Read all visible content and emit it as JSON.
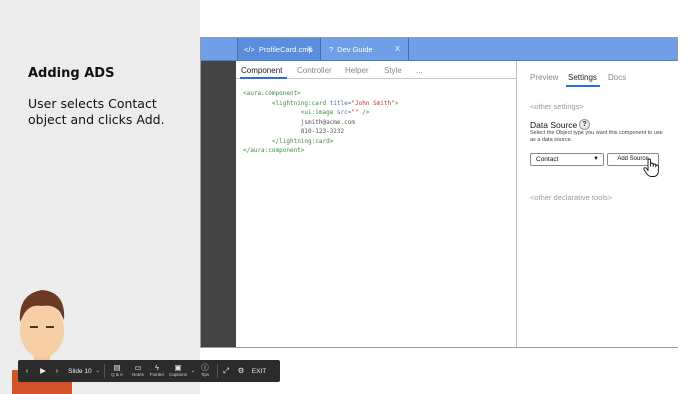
{
  "slide": {
    "title": "Adding ADS",
    "body": "User selects Contact object and clicks Add."
  },
  "player": {
    "prev_icon": "prev-icon",
    "play_icon": "play-icon",
    "next_icon": "next-icon",
    "slide_label": "Slide 10",
    "qa_label": "Q & A",
    "notes_label": "Notes",
    "pointer_label": "Pointer",
    "captions_label": "Captions",
    "tips_label": "Tips",
    "exit_label": "EXIT"
  },
  "tabs": [
    {
      "icon": "</>",
      "label": "ProfileCard.cmp",
      "close": "X"
    },
    {
      "icon": "?",
      "label": "Dev Guide",
      "close": "X"
    }
  ],
  "editor": {
    "tabs": [
      "Component",
      "Controller",
      "Helper",
      "Style",
      "..."
    ],
    "active_tab": "Component",
    "code": {
      "l1": "<aura:component>",
      "l2_tag": "<lightning:card",
      "l2_attr": " title=",
      "l2_val": "\"John Smith\"",
      "l2_end": ">",
      "l3_tag": "<ui:image",
      "l3_attr": " src=",
      "l3_val": "\"\"",
      "l3_end": " />",
      "l4": "jsmith@acme.com",
      "l5": "810-123-3232",
      "l6": "</lightning:card>",
      "l7": "</aura:component>"
    }
  },
  "panel": {
    "tabs": [
      "Preview",
      "Settings",
      "Docs"
    ],
    "active_tab": "Settings",
    "other_settings": "<other settings>",
    "data_source_title": "Data Source",
    "help_glyph": "?",
    "data_source_desc": "Select the Object type you want this component to use as a data source.",
    "select_value": "Contact",
    "add_button": "Add Source",
    "other_tools": "<other declarative tools>"
  },
  "colors": {
    "tabbar": "#6f9fe6",
    "accent": "#2d6fd6",
    "gutter": "#444444",
    "player_bg": "#2b2b2b"
  }
}
